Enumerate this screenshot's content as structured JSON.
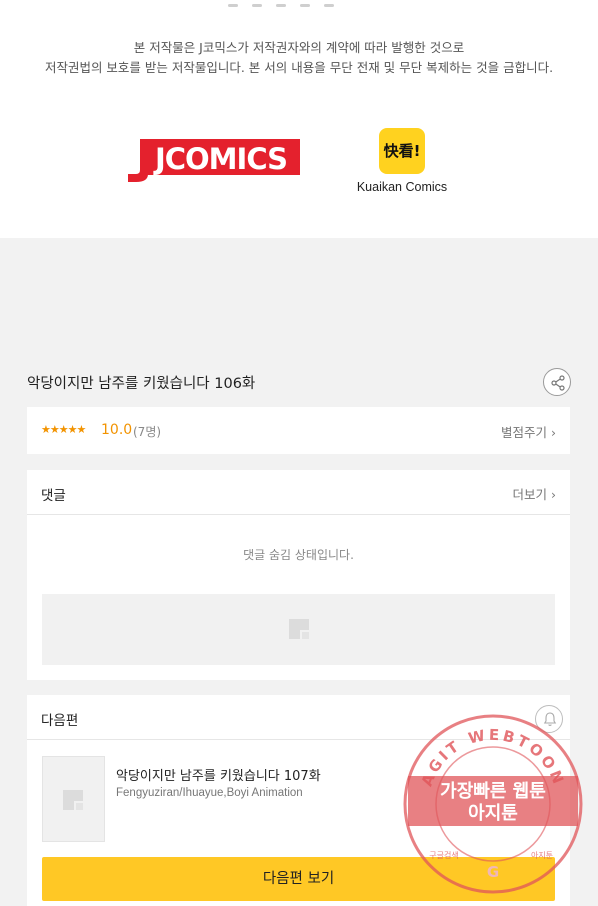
{
  "notice": {
    "line1": "본 저작물은 J코믹스가 저작권자와의 계약에 따라 발행한 것으로",
    "line2": "저작권법의 보호를 받는 저작물입니다. 본 서의 내용을 무단 전재 및 무단 복제하는 것을 금합니다."
  },
  "publishers": {
    "jcomics": "JCOMICS",
    "kuaikan_logo_text": "快看!",
    "kuaikan_name": "Kuaikan Comics"
  },
  "episode": {
    "title": "악당이지만 남주를 키웠습니다 106화"
  },
  "rating": {
    "stars": "★★★★★",
    "score": "10.0",
    "count": "(7명)",
    "rate_link": "별점주기 ›"
  },
  "comments": {
    "label": "댓글",
    "more": "더보기 ›",
    "hidden_message": "댓글 숨김 상태입니다."
  },
  "next_episode": {
    "label": "다음편",
    "title": "악당이지만 남주를 키웠습니다 107화",
    "authors": "Fengyuziran/Ihuayue,Boyi Animation",
    "button": "다음편 보기"
  },
  "watermark": {
    "arc_text": "AGIT WEBTOON",
    "line1": "가장빠른 웹툰",
    "line2": "아지툰",
    "bottom_left": "구글검색",
    "bottom_mid": "G",
    "bottom_right": "아지툰"
  },
  "colors": {
    "accent_orange": "#f29300",
    "button_yellow": "#ffc825",
    "jcomics_red": "#e4212d",
    "kuaikan_yellow": "#ffd21f",
    "watermark_red": "#e0555a"
  },
  "icons": [
    "share-icon",
    "bell-icon",
    "image-placeholder-icon"
  ]
}
